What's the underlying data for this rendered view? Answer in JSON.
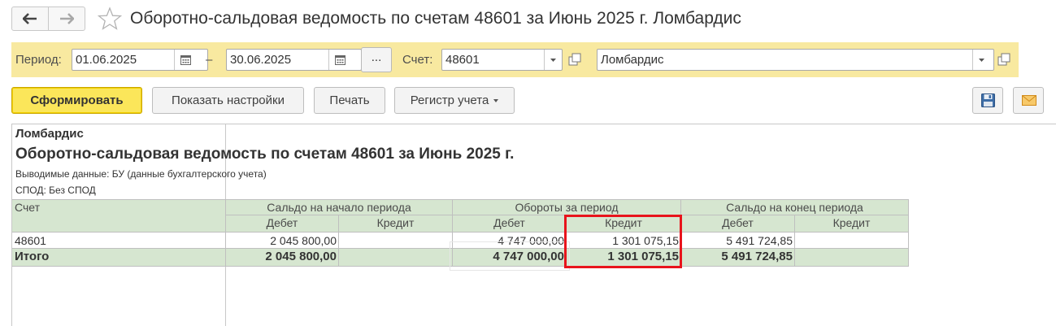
{
  "window": {
    "title": "Оборотно-сальдовая ведомость по счетам 48601 за Июнь 2025 г. Ломбардис"
  },
  "params": {
    "period_label": "Период:",
    "date_from": "01.06.2025",
    "dash": "–",
    "date_to": "30.06.2025",
    "more_label": "...",
    "account_label": "Счет:",
    "account_value": "48601",
    "organization_value": "Ломбардис"
  },
  "toolbar": {
    "generate_label": "Сформировать",
    "show_settings_label": "Показать настройки",
    "print_label": "Печать",
    "register_label": "Регистр учета"
  },
  "report": {
    "organization": "Ломбардис",
    "title": "Оборотно-сальдовая ведомость по счетам 48601 за Июнь 2025 г.",
    "output_data_line": "Выводимые данные:  БУ (данные бухгалтерского учета)",
    "spod_line": "СПОД: Без СПОД",
    "table": {
      "account_header": "Счет",
      "group_headers": [
        "Сальдо на начало периода",
        "Обороты за период",
        "Сальдо на конец периода"
      ],
      "sub_headers": [
        "Дебет",
        "Кредит",
        "Дебет",
        "Кредит",
        "Дебет",
        "Кредит"
      ],
      "rows": [
        {
          "account": "48601",
          "opening_debit": "2 045 800,00",
          "opening_credit": "",
          "turnover_debit": "4 747 000,00",
          "turnover_credit": "1 301 075,15",
          "closing_debit": "5 491 724,85",
          "closing_credit": ""
        }
      ],
      "total": {
        "label": "Итого",
        "opening_debit": "2 045 800,00",
        "opening_credit": "",
        "turnover_debit": "4 747 000,00",
        "turnover_credit": "1 301 075,15",
        "closing_debit": "5 491 724,85",
        "closing_credit": ""
      }
    }
  },
  "colors": {
    "param_panel_bg": "#f8e9a0",
    "primary_button_bg": "#fbe65a",
    "table_header_bg": "#d6e6d0",
    "highlight_border": "#e8141c"
  }
}
